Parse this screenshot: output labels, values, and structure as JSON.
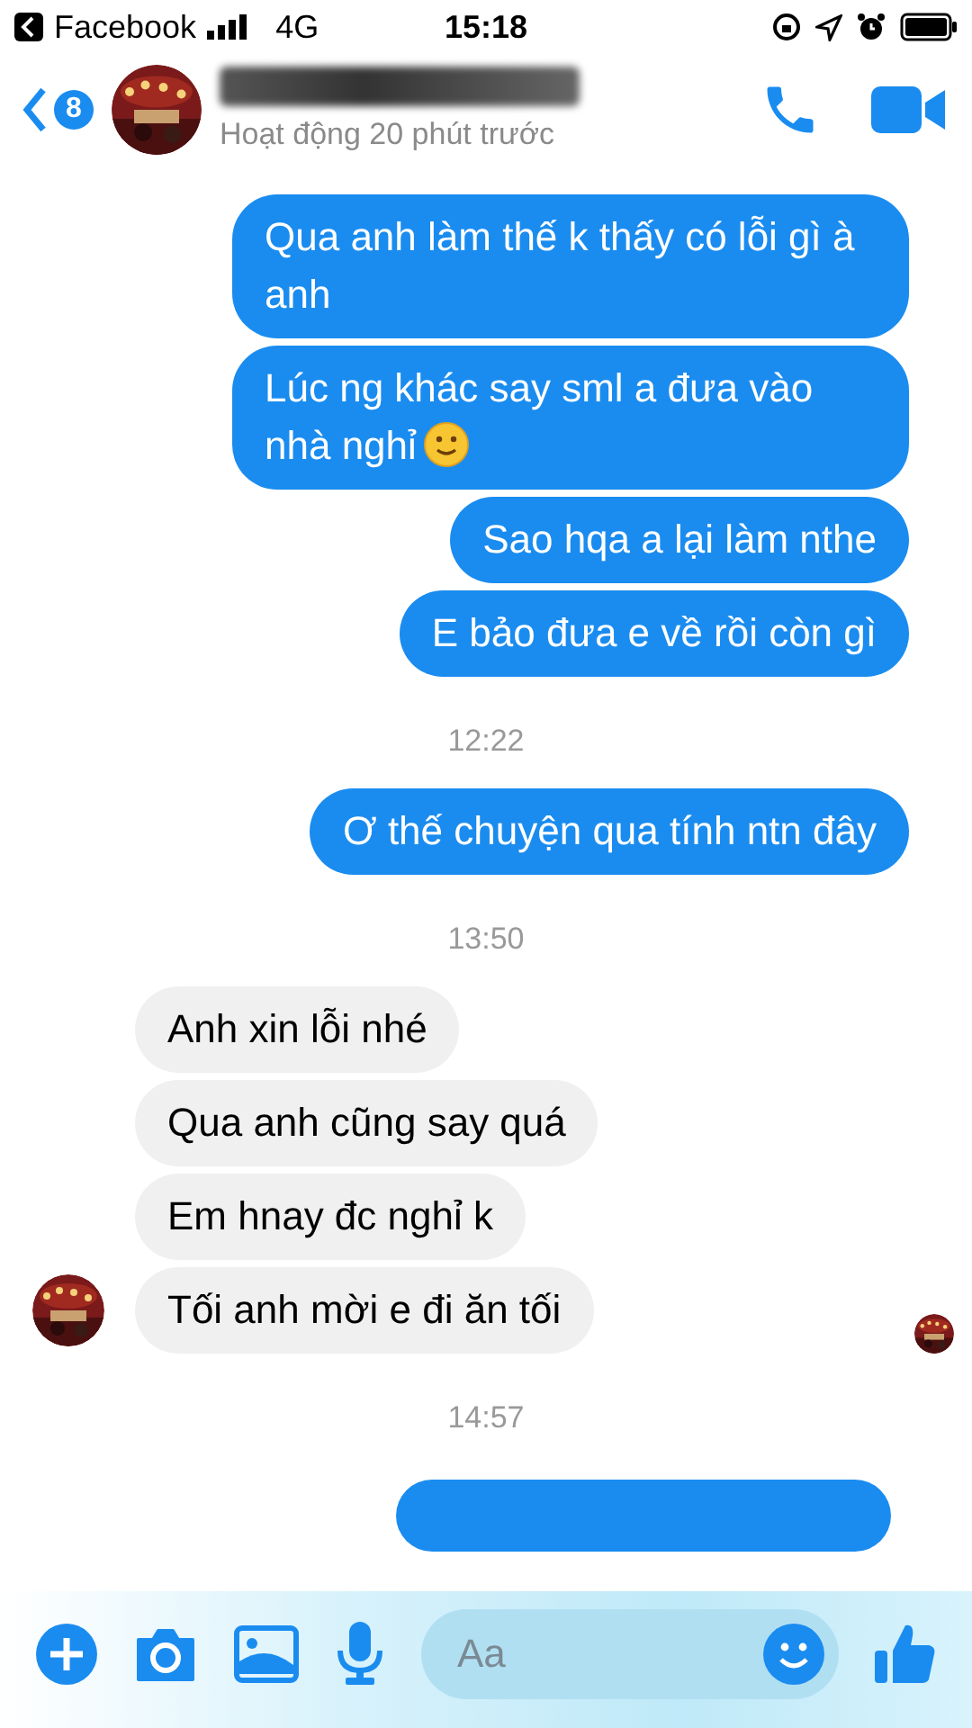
{
  "status_bar": {
    "back_app": "Facebook",
    "network": "4G",
    "time": "15:18"
  },
  "header": {
    "back_badge": "8",
    "status": "Hoạt động 20 phút trước"
  },
  "messages": [
    {
      "kind": "outgoing",
      "text": "Qua anh làm thế k thấy có lỗi gì à anh",
      "emoji": false
    },
    {
      "kind": "outgoing",
      "text": "Lúc ng khác say sml a đưa vào nhà nghỉ",
      "emoji": true
    },
    {
      "kind": "outgoing",
      "text": "Sao hqa a lại làm nthe",
      "emoji": false
    },
    {
      "kind": "outgoing",
      "text": "E bảo đưa e về rồi còn gì",
      "emoji": false
    },
    {
      "kind": "timestamp",
      "text": "12:22"
    },
    {
      "kind": "outgoing",
      "text": "Ơ thế chuyện qua tính ntn đây",
      "emoji": false
    },
    {
      "kind": "timestamp",
      "text": "13:50"
    },
    {
      "kind": "incoming",
      "text": "Anh xin lỗi nhé",
      "avatar": false,
      "seen": false
    },
    {
      "kind": "incoming",
      "text": "Qua anh cũng say quá",
      "avatar": false,
      "seen": false
    },
    {
      "kind": "incoming",
      "text": "Em hnay đc nghỉ k",
      "avatar": false,
      "seen": false
    },
    {
      "kind": "incoming",
      "text": "Tối anh mời e đi ăn tối",
      "avatar": true,
      "seen": true
    },
    {
      "kind": "timestamp",
      "text": "14:57"
    }
  ],
  "composer": {
    "placeholder": "Aa"
  }
}
